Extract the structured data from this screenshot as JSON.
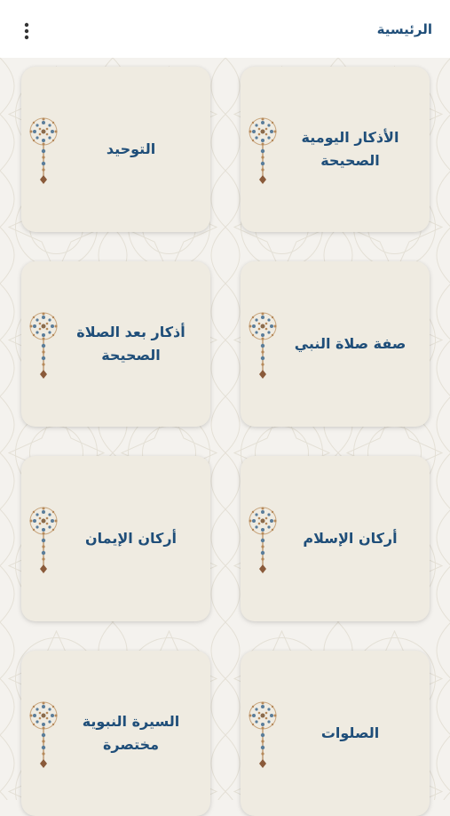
{
  "app_bar": {
    "title": "الرئيسية",
    "menu_icon": "more-vertical-icon"
  },
  "colors": {
    "title_text": "#1f4e79",
    "card_background": "#efebe1",
    "page_background": "#f4f2ee",
    "ornament_gold": "#b5895a",
    "ornament_blue": "#5a7d9a"
  },
  "cards": [
    {
      "label": "الأذكار اليومية\nالصحيحة",
      "icon": "ornament-icon"
    },
    {
      "label": "التوحيد",
      "icon": "ornament-icon"
    },
    {
      "label": "صفة صلاة النبي",
      "icon": "ornament-icon"
    },
    {
      "label": "أذكار بعد الصلاة\nالصحيحة",
      "icon": "ornament-icon"
    },
    {
      "label": "أركان الإسلام",
      "icon": "ornament-icon"
    },
    {
      "label": "أركان الإيمان",
      "icon": "ornament-icon"
    },
    {
      "label": "الصلوات",
      "icon": "ornament-icon"
    },
    {
      "label": "السيرة النبوية\nمختصرة",
      "icon": "ornament-icon"
    }
  ]
}
